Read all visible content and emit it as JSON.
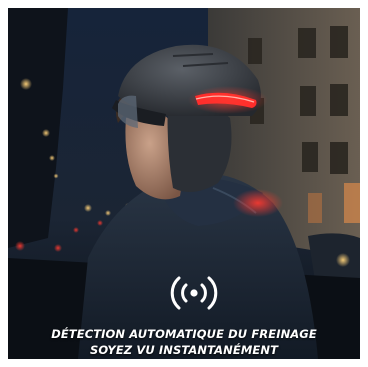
{
  "caption": {
    "line1": "DÉTECTION AUTOMATIQUE DU FREINAGE",
    "line2": "SOYEZ VU INSTANTANÉMENT"
  },
  "icons": {
    "signal": "wireless-signal-icon"
  },
  "colors": {
    "brake_light": "#ff2a2a",
    "sky": "#0f1a2b",
    "jacket": "#1c2838",
    "helmet": "#3a3f45"
  }
}
